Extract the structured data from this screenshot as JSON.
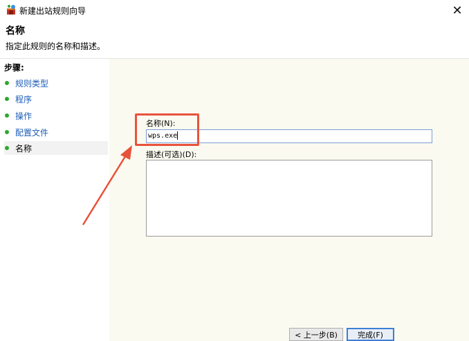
{
  "window": {
    "title": "新建出站规则向导",
    "close_glyph": "✕"
  },
  "header": {
    "title": "名称",
    "description": "指定此规则的名称和描述。"
  },
  "sidebar": {
    "steps_label": "步骤:",
    "items": [
      {
        "label": "规则类型",
        "current": false
      },
      {
        "label": "程序",
        "current": false
      },
      {
        "label": "操作",
        "current": false
      },
      {
        "label": "配置文件",
        "current": false
      },
      {
        "label": "名称",
        "current": true
      }
    ]
  },
  "form": {
    "name_label": "名称(N):",
    "name_value": "wps.exe",
    "description_label": "描述(可选)(D):",
    "description_value": ""
  },
  "buttons": {
    "back_label": "< 上一步(B)",
    "finish_label": "完成(F)"
  },
  "colors": {
    "annotation": "#e8523a",
    "step_dot": "#2da82d",
    "link": "#1c5cb8"
  },
  "icons": {
    "app": "firewall-icon",
    "close": "close-icon",
    "step": "green-dot-icon"
  }
}
